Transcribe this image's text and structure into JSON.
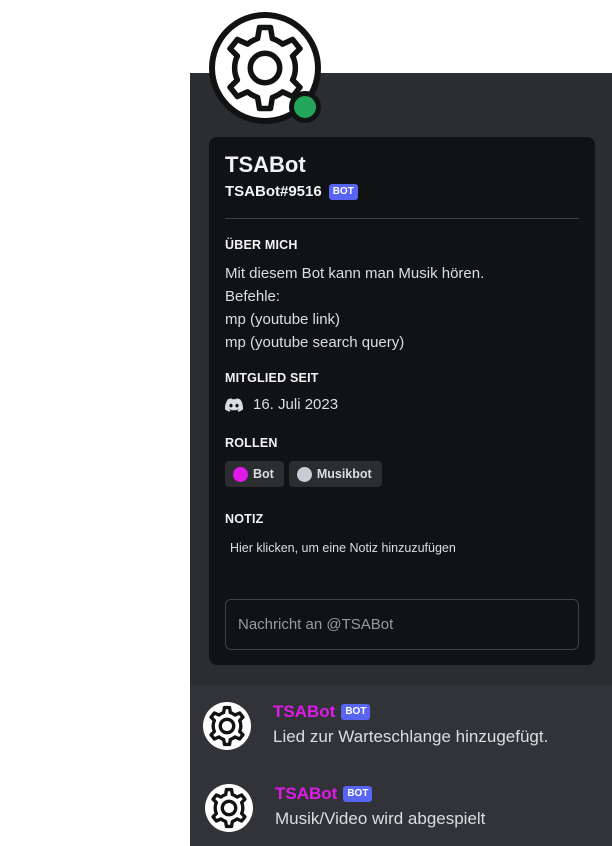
{
  "profile": {
    "username": "TSABot",
    "tag": "TSABot#9516",
    "badge": "BOT",
    "status_color": "#23a55a",
    "avatar_icon": "gear-icon"
  },
  "about": {
    "title": "ÜBER MICH",
    "lines": [
      "Mit diesem Bot kann man Musik hören.",
      "Befehle:",
      "mp (youtube link)",
      "mp (youtube search query)"
    ]
  },
  "member_since": {
    "title": "MITGLIED SEIT",
    "icon": "discord-icon",
    "date": "16. Juli 2023"
  },
  "roles": {
    "title": "ROLLEN",
    "items": [
      {
        "label": "Bot",
        "color": "#e01ae8"
      },
      {
        "label": "Musikbot",
        "color": "#c9cdd3"
      }
    ]
  },
  "note": {
    "title": "NOTIZ",
    "hint": "Hier klicken, um eine Notiz hinzuzufügen"
  },
  "message_input": {
    "placeholder": "Nachricht an @TSABot"
  },
  "chat": {
    "messages": [
      {
        "author": "TSABot",
        "badge": "BOT",
        "text": "Lied zur Warteschlange hinzugefügt."
      },
      {
        "author": "TSABot",
        "badge": "BOT",
        "text": "Musik/Video wird abgespielt"
      }
    ]
  },
  "colors": {
    "background": "#2b2d31",
    "inner_card": "#111214",
    "accent_badge": "#5865f2",
    "bot_role": "#e01ae8"
  }
}
